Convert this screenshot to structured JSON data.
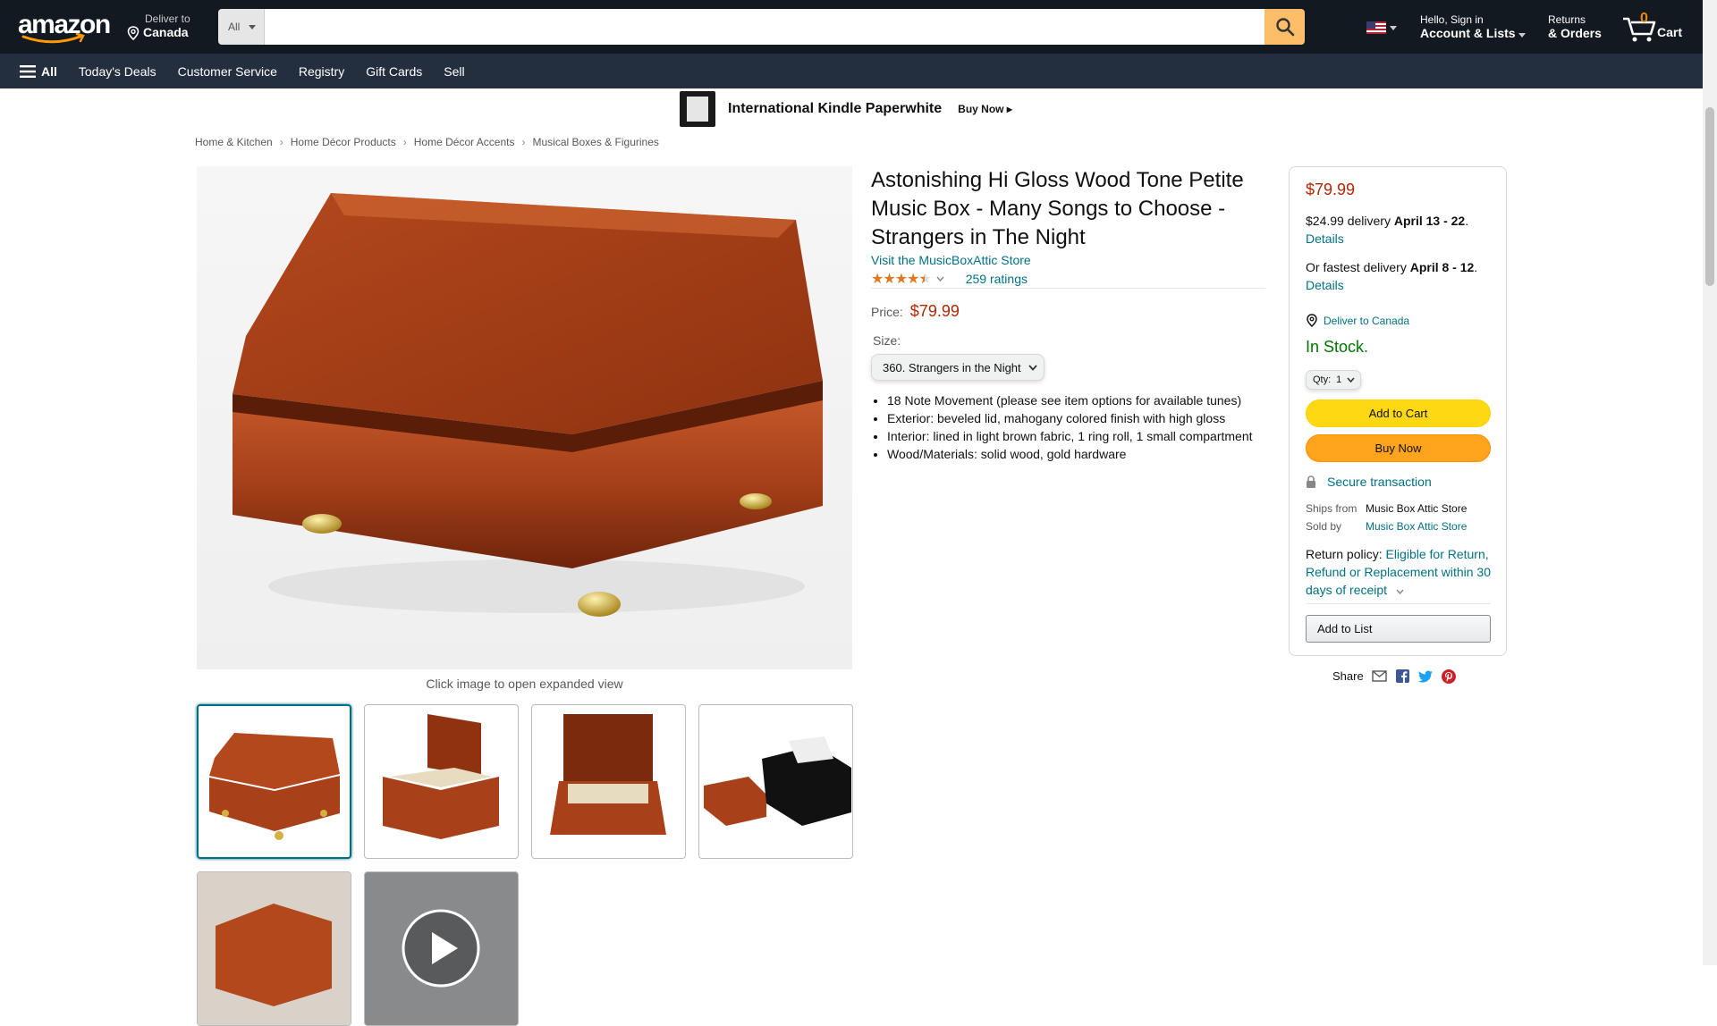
{
  "header": {
    "logo": "amazon",
    "deliver_line1": "Deliver to",
    "deliver_line2": "Canada",
    "search_category": "All",
    "search_placeholder": "",
    "account_line1": "Hello, Sign in",
    "account_line2": "Account & Lists",
    "returns_line1": "Returns",
    "returns_line2": "& Orders",
    "cart_count": "0",
    "cart_label": "Cart"
  },
  "subnav": {
    "all_label": "All",
    "items": [
      "Today's Deals",
      "Customer Service",
      "Registry",
      "Gift Cards",
      "Sell"
    ]
  },
  "banner": {
    "title": "International Kindle Paperwhite",
    "cta": "Buy Now ▸"
  },
  "breadcrumb": [
    "Home & Kitchen",
    "Home Décor Products",
    "Home Décor Accents",
    "Musical Boxes & Figurines"
  ],
  "gallery": {
    "caption": "Click image to open expanded view"
  },
  "product": {
    "title": "Astonishing Hi Gloss Wood Tone Petite Music Box - Many Songs to Choose - Strangers in The Night",
    "store_link": "Visit the MusicBoxAttic Store",
    "rating": 4.5,
    "ratings_count": "259 ratings",
    "price_label": "Price:",
    "price": "$79.99",
    "size_label": "Size:",
    "size_value": "360. Strangers in the Night",
    "bullets": [
      "18 Note Movement (please see item options for available tunes)",
      "Exterior: beveled lid, mahogany colored finish with high gloss",
      "Interior: lined in light brown fabric, 1 ring roll, 1 small compartment",
      "Wood/Materials: solid wood, gold hardware"
    ]
  },
  "buybox": {
    "price": "$79.99",
    "delivery_prefix": "$24.99 delivery ",
    "delivery_date": "April 13 - 22",
    "details1": "Details",
    "fastest_prefix": "Or fastest delivery ",
    "fastest_date": "April 8 - 12",
    "details2": "Details",
    "deliver_to": "Deliver to Canada",
    "stock": "In Stock.",
    "qty_label": "Qty:",
    "qty_value": "1",
    "add_to_cart": "Add to Cart",
    "buy_now": "Buy Now",
    "secure": "Secure transaction",
    "ships_from_label": "Ships from",
    "ships_from_value": "Music Box Attic Store",
    "sold_by_label": "Sold by",
    "sold_by_value": "Music Box Attic Store",
    "return_label": "Return policy: ",
    "return_link": "Eligible for Return, Refund or Replacement within 30 days of receipt",
    "add_to_list": "Add to List"
  },
  "share": {
    "label": "Share"
  },
  "colors": {
    "nav_bg": "#131921",
    "subnav_bg": "#232f3e",
    "link": "#007185",
    "price": "#b12704",
    "in_stock": "#007600",
    "cart_btn": "#ffd814",
    "buy_btn": "#ffa41c"
  }
}
